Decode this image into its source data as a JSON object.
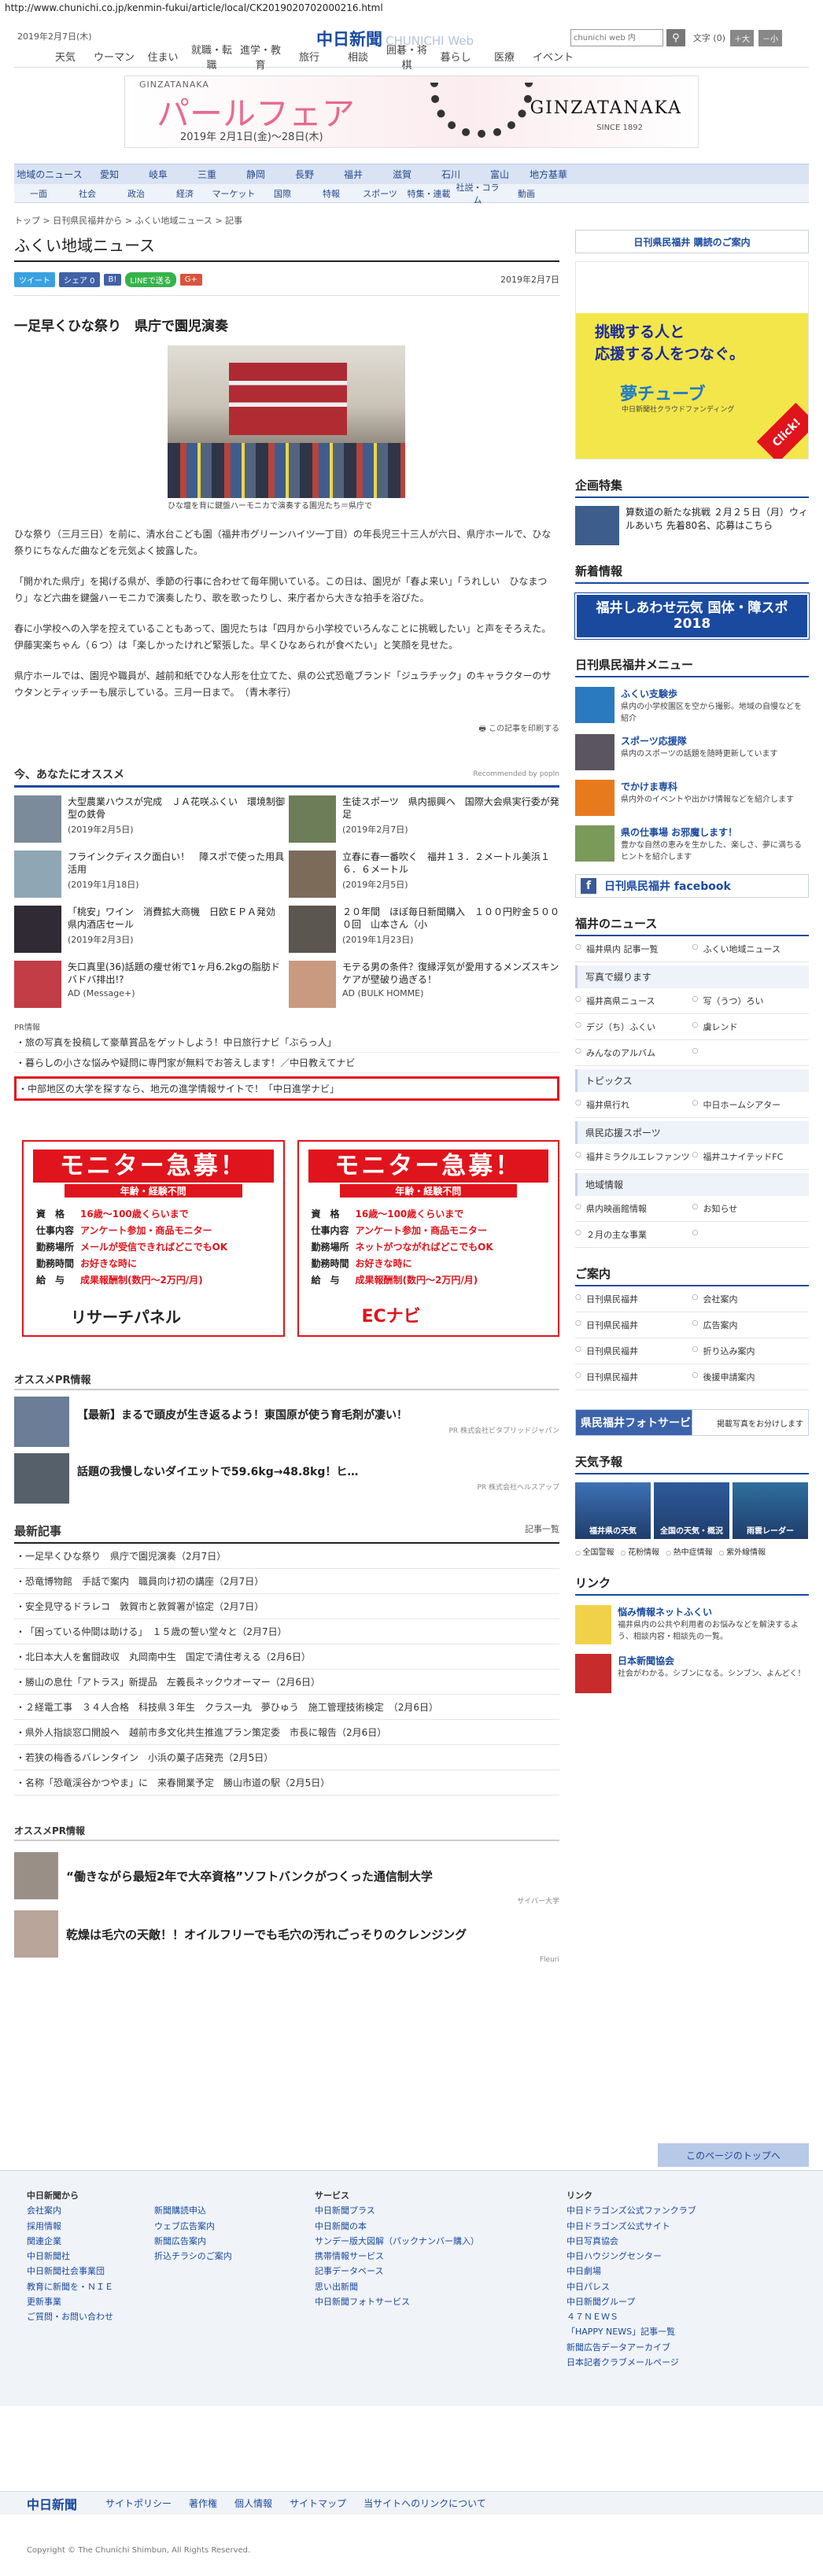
{
  "url": "http://www.chunichi.co.jp/kenmin-fukui/article/local/CK2019020702000216.html",
  "topbar": {
    "date": "2019年2月7日(木)",
    "logo_main": "中日新聞",
    "logo_sub": "CHUNICHI Web",
    "search_placeholder": "chunichi web 内",
    "search_icon": "magnifier-icon",
    "font_label": "文字",
    "font_size_state": "(0)",
    "font_bigger": "＋大",
    "font_smaller": "－小"
  },
  "gnav": [
    "天気",
    "ウーマン",
    "住まい",
    "就職・転職",
    "進学・教育",
    "旅行",
    "相談",
    "囲碁・将棋",
    "暮らし",
    "医療",
    "イベント"
  ],
  "banner": {
    "ginzatanaka_small": "GINZATANAKA",
    "title": "パールフェア",
    "dates": "2019年 2月1日(金)〜28日(木)",
    "brand": "GINZATANAKA",
    "since": "SINCE 1892"
  },
  "cat1": [
    "地域のニュース",
    "愛知",
    "岐阜",
    "三重",
    "静岡",
    "長野",
    "福井",
    "滋賀",
    "石川",
    "富山",
    "地方基華"
  ],
  "cat2": [
    "一面",
    "社会",
    "政治",
    "経済",
    "マーケット",
    "国際",
    "特報",
    "スポーツ",
    "特集・連載",
    "社説・コラム",
    "動画"
  ],
  "breadcrumb": "トップ > 日刊県民福井から > ふくい地域ニュース > 記事",
  "section_title": "ふくい地域ニュース",
  "share": {
    "tweet": "ツイート",
    "fb": "シェア 0",
    "hatena": "B!",
    "line": "LINEで送る",
    "gplus": "G+"
  },
  "article_date": "2019年2月7日",
  "headline": "一足早くひな祭り　県庁で園児演奏",
  "photo_caption": "ひな壇を背に鍵盤ハーモニカで演奏する園児たち＝県庁で",
  "paragraphs": [
    "ひな祭り（三月三日）を前に、清水台こども園（福井市グリーンハイツ一丁目）の年長児三十三人が六日、県庁ホールで、ひな祭りにちなんだ曲などを元気よく披露した。",
    "「開かれた県庁」を掲げる県が、季節の行事に合わせて毎年開いている。この日は、園児が「春よ来い」「うれしい　ひなまつり」など六曲を鍵盤ハーモニカで演奏したり、歌を歌ったりし、来庁者から大きな拍手を浴びた。",
    "春に小学校への入学を控えていることもあって、園児たちは「四月から小学校でいろんなことに挑戦したい」と声をそろえた。伊藤実楽ちゃん（６つ）は「楽しかったけれど緊張した。早くひなあられが食べたい」と笑顔を見せた。",
    "県庁ホールでは、園児や職員が、越前和紙でひな人形を仕立てた、県の公式恐竜ブランド「ジュラチック」のキャラクターのサウタンとティッチーも展示している。三月一日まで。　（青木孝行）"
  ],
  "print_label": "この記事を印刷する",
  "recommend": {
    "title": "今、あなたにオススメ",
    "by": "Recommended by popIn",
    "items": [
      {
        "title": "大型農業ハウスが完成　ＪＡ花咲ふくい　環境制御型の鉄骨",
        "date": "(2019年2月5日)",
        "color": "#7b8b9a"
      },
      {
        "title": "生徒スポーツ　県内振興へ　国際大会県実行委が発足",
        "date": "(2019年2月7日)",
        "color": "#6d7d58"
      },
      {
        "title": "フラインクディスク面白い！　障スポで使った用具活用",
        "date": "(2019年1月18日)",
        "color": "#8fa6b5"
      },
      {
        "title": "立春に春一番吹く　福井１３．２メートル美浜１６．６メートル",
        "date": "(2019年2月5日)",
        "color": "#7d6b5a"
      },
      {
        "title": "「桃安」ワイン　消費拡大商機　日欧ＥＰＡ発効　県内酒店セール",
        "date": "(2019年2月3日)",
        "color": "#2f2a34"
      },
      {
        "title": "２０年間　ほぼ毎日新聞購入　１００円貯金５０００回　山本さん（小",
        "date": "(2019年1月23日)",
        "color": "#5c5650"
      },
      {
        "title": "矢口真里(36)話題の痩せ術で1ヶ月6.2kgの脂肪ドバドバ排出!?",
        "date": "AD (Message+)",
        "color": "#c23d45"
      },
      {
        "title": "モテる男の条件？復縁浮気が愛用するメンズスキンケアが壁破り過ぎる！",
        "date": "AD (BULK HOMME)",
        "color": "#c99a7f"
      }
    ]
  },
  "pr_label": "PR情報",
  "pr_list": [
    "旅の写真を投稿して豪華賞品をゲットしよう！中日旅行ナビ「ぶらっ人」",
    "暮らしの小さな悩みや疑問に専門家が無料でお答えします！／中日教えてナビ",
    "中部地区の大学を探すなら、地元の進学情報サイトで！「中日進学ナビ」"
  ],
  "monitor_ads": [
    {
      "head": "モニター急募！",
      "sub": "年齢・経験不問",
      "rows": [
        [
          "資　格",
          "16歳～100歳くらいまで"
        ],
        [
          "仕事内容",
          "アンケート参加・商品モニター"
        ],
        [
          "勤務場所",
          "メールが受信できればどこでもOK"
        ],
        [
          "勤務時間",
          "お好きな時に"
        ],
        [
          "給　与",
          "成果報酬制(数円～2万円/月)"
        ]
      ],
      "logo": "リサーチパネル"
    },
    {
      "head": "モニター急募！",
      "sub": "年齢・経験不問",
      "rows": [
        [
          "資　格",
          "16歳～100歳くらいまで"
        ],
        [
          "仕事内容",
          "アンケート参加・商品モニター"
        ],
        [
          "勤務場所",
          "ネットがつながればどこでもOK"
        ],
        [
          "勤務時間",
          "お好きな時に"
        ],
        [
          "給　与",
          "成果報酬制(数円～2万円/月)"
        ]
      ],
      "logo": "ECナビ"
    }
  ],
  "oss_pr": {
    "title": "オススメPR情報",
    "items": [
      {
        "title": "【最新】まるで頭皮が生き返るよう！東国原が使う育毛剤が凄い！",
        "src": "PR 株式会社ビタブリッドジャパン"
      },
      {
        "title": "話題の我慢しないダイエットで59.6kg→48.8kg！ヒ…",
        "src": "PR 株式会社ヘルスアップ"
      }
    ]
  },
  "latest": {
    "title": "最新記事",
    "more": "記事一覧",
    "items": [
      "一足早くひな祭り　県庁で園児演奏（2月7日）",
      "恐竜博物館　手話で案内　職員向け初の講座（2月7日）",
      "安全見守るドラレコ　敦賀市と敦賀署が協定（2月7日）",
      "「困っている仲間は助ける」　１５歳の誓い堂々と（2月7日）",
      "北日本大人を奮闘政収　丸岡南中生　国定で清住考える（2月6日）",
      "勝山の息仕「アトラス」新提品　左義長ネックウオーマー（2月6日）",
      "２経電工事　３４人合格　科技県３年生　クラス一丸　夢ひゅう　施工管理技術検定　（2月6日）",
      "県外人指談窓口開設へ　越前市多文化共生推進プラン策定委　市長に報告（2月6日）",
      "若狭の梅香るバレンタイン　小浜の菓子店発売（2月5日）",
      "名称「恐竜渓谷かつやま」に　来春開業予定　勝山市道の駅（2月5日）"
    ]
  },
  "oss_pr2": {
    "title": "オススメPR情報",
    "items": [
      {
        "title": "“働きながら最短2年で大卒資格”ソフトバンクがつくった通信制大学",
        "src": "サイバー大学"
      },
      {
        "title": "乾燥は毛穴の天敵！！オイルフリーでも毛穴の汚れごっそりのクレンジング",
        "src": "Fleuri"
      }
    ]
  },
  "side": {
    "subscribe": "日刊県民福井 購読のご案内",
    "ad_copy": "挑戦する人と\n応援する人をつなぐ。",
    "ad_brand": "夢チューブ",
    "ad_tag": "中日新聞社クラウドファンディング",
    "ad_click": "Click!",
    "kikaku_title": "企画特集",
    "kikaku_text": "算数道の新たな挑戦 ２月２５日（月）ウィルあいち 先着80名、応募はこちら",
    "shinchaku_title": "新着情報",
    "shinchaku_banner": "福井しあわせ元気 国体・障スポ 2018",
    "menu_title": "日刊県民福井メニュー",
    "menu": [
      {
        "t": "ふくい支験歩",
        "d": "県内の小学校園区を空から撮影。地域の自慢などを紹介",
        "c": "#2a7abf"
      },
      {
        "t": "スポーツ応援隊",
        "d": "県内のスポーツの話題を随時更新しています",
        "c": "#5a5560"
      },
      {
        "t": "でかけま専科",
        "d": "県内外のイベントや出かけ情報などを紹介します",
        "c": "#e87a1e"
      },
      {
        "t": "県の仕事場 お邪魔します！",
        "d": "豊かな自然の恵みを生かした、楽しさ、夢に満ちるヒントを紹介します",
        "c": "#7a9a5a"
      }
    ],
    "facebook": "日刊県民福井 facebook",
    "fukui_news": "福井のニュース",
    "news_links": [
      [
        "福井県内 記事一覧",
        "ふくい地域ニュース"
      ]
    ],
    "photo_head": "写真で綴ります",
    "photo_links": [
      [
        "福井高県ニュース",
        "写（うつ）ろい"
      ],
      [
        "デジ（ち）ふくい",
        "虜レンド"
      ],
      [
        "みんなのアルバム",
        ""
      ]
    ],
    "topics_head": "トピックス",
    "topics_links": [
      [
        "福井県行れ",
        "中日ホームシアター"
      ]
    ],
    "sports_head": "県民応援スポーツ",
    "sports_links": [
      [
        "福井ミラクルエレファンツ",
        "福井ユナイテッドFC"
      ]
    ],
    "info_head": "地域情報",
    "info_links": [
      [
        "県内映画館情報",
        "お知らせ"
      ],
      [
        "２月の主な事業",
        ""
      ]
    ],
    "guide_title": "ご案内",
    "guide_links": [
      [
        "日刊県民福井",
        "会社案内"
      ],
      [
        "日刊県民福井",
        "広告案内"
      ],
      [
        "日刊県民福井",
        "折り込み案内"
      ],
      [
        "日刊県民福井",
        "後援申請案内"
      ]
    ],
    "photo_service": "県民福井フォトサービス",
    "photo_service_sub": "掲載写真をお分けします",
    "weather_title": "天気予報",
    "weather": [
      {
        "n": "福井県の天気",
        "c": "#3d71b6"
      },
      {
        "n": "全国の天気・概況",
        "c": "#2e5a9b"
      },
      {
        "n": "雨雲レーダー",
        "c": "#2f6f9e"
      }
    ],
    "weather_links": [
      "全国警報",
      "花粉情報",
      "熱中症情報",
      "紫外線情報"
    ],
    "link_title": "リンク",
    "links": [
      {
        "t": "悩み情報ネットふくい",
        "d": "福井県内の公共や利用者のお悩みなどを解決するよう、相談内容・相談先の一覧。"
      },
      {
        "t": "日本新聞協会",
        "d": "社会がわかる。シブンになる。シンブン、よんどく！"
      }
    ]
  },
  "totop": "このページのトップへ",
  "footer": {
    "cols": [
      {
        "h": "中日新聞から",
        "items": [
          "会社案内",
          "採用情報",
          "関連企業",
          "中日新聞社",
          "中日新聞社会事業団",
          "教育に新聞を・ＮＩＥ",
          "更新事業",
          "ご質問・お問い合わせ"
        ]
      },
      {
        "h": "",
        "items": [
          "新聞購読申込",
          "ウェブ広告案内",
          "新聞広告案内",
          "折込チラシのご案内"
        ]
      },
      {
        "h": "サービス",
        "items": [
          "中日新聞プラス",
          "中日新聞の本",
          "サンデー版大図解（パックナンバー購入）",
          "携帯情報サービス",
          "記事データベース",
          "思い出新聞",
          "中日新聞フォトサービス"
        ]
      },
      {
        "h": "リンク",
        "items": [
          "中日ドラゴンズ公式ファンクラブ",
          "中日ドラゴンズ公式サイト",
          "中日写真協会",
          "中日ハウジングセンター",
          "中日劇場",
          "中日パレス",
          "中日新聞グループ",
          "４７ＮＥＷＳ",
          "「HAPPY NEWS」記事一覧",
          "新聞広告データアーカイブ",
          "日本記者クラブメールページ"
        ]
      }
    ],
    "nav_logo": "中日新聞",
    "nav": [
      "サイトポリシー",
      "著作権",
      "個人情報",
      "サイトマップ",
      "当サイトへのリンクについて"
    ],
    "copyright": "Copyright © The Chunichi Shimbun, All Rights Reserved."
  }
}
